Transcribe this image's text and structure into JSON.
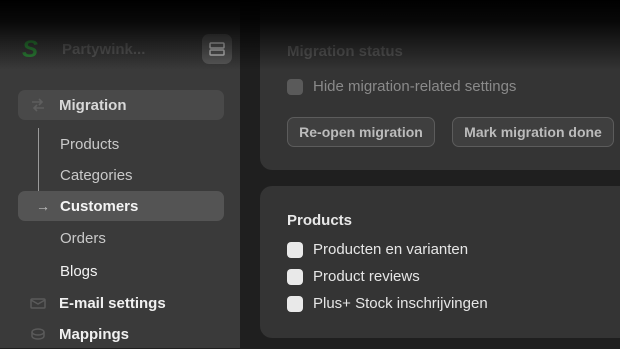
{
  "brand": {
    "name": "Partywink...",
    "logo_letter": "S",
    "logo_icon": "brand-s-logo",
    "switch_icon": "switch-store-icon"
  },
  "sidebar": {
    "group": {
      "label": "Migration",
      "icon": "migration-icon"
    },
    "subitems": [
      {
        "label": "Products"
      },
      {
        "label": "Categories"
      },
      {
        "label": "Customers",
        "active": true
      },
      {
        "label": "Orders"
      },
      {
        "label": "Blogs"
      }
    ],
    "arrow": "→",
    "items": [
      {
        "label": "E-mail settings",
        "icon": "mail-icon"
      },
      {
        "label": "Mappings",
        "icon": "mappings-icon"
      }
    ]
  },
  "migration_status": {
    "title": "Migration status",
    "checkbox_label": "Hide migration-related settings",
    "buttons": [
      "Re-open migration",
      "Mark migration done"
    ]
  },
  "products": {
    "title": "Products",
    "options": [
      "Producten en varianten",
      "Product reviews",
      "Plus+ Stock inschrijvingen"
    ]
  },
  "colors": {
    "brand_green": "#2f8a3a",
    "background": "#1f1f1f",
    "sidebar": "#3a3a3a",
    "card": "#343434"
  }
}
